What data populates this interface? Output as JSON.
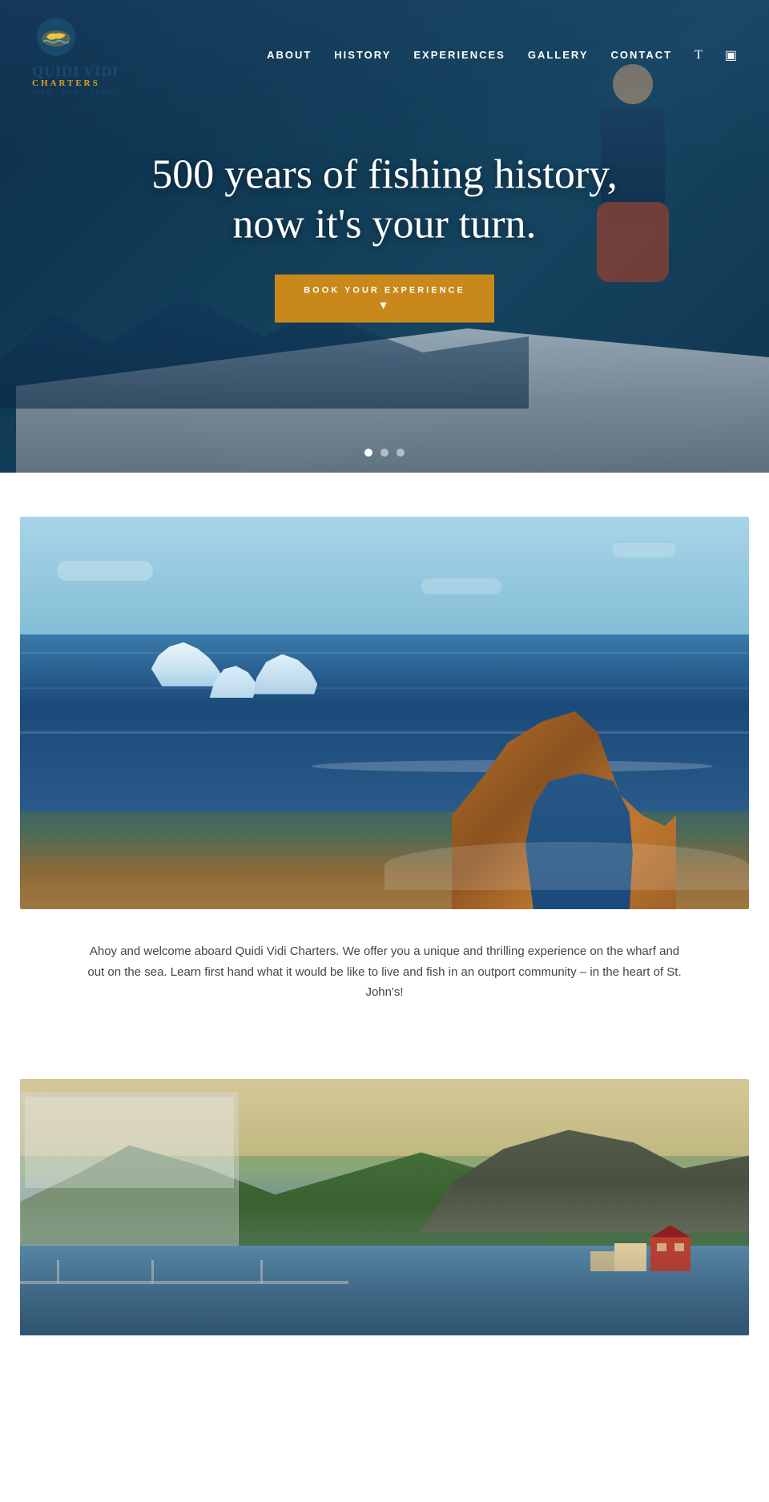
{
  "site": {
    "name_line1": "QUIDI VIDI",
    "name_line2": "CHARTERS",
    "tagline": "FISH · FUN · FEAST"
  },
  "nav": {
    "items": [
      {
        "id": "about",
        "label": "ABOUT"
      },
      {
        "id": "history",
        "label": "HISTORY"
      },
      {
        "id": "experiences",
        "label": "EXPERIENCES"
      },
      {
        "id": "gallery",
        "label": "GALLERY"
      },
      {
        "id": "contact",
        "label": "CONTACT"
      }
    ],
    "icon1": "T",
    "icon2": "▣"
  },
  "hero": {
    "title": "500 years of fishing history, now it's your turn.",
    "cta_label": "BOOK YOUR EXPERIENCE",
    "cta_arrow": "▼",
    "dots": [
      {
        "active": true
      },
      {
        "active": false
      },
      {
        "active": false
      }
    ]
  },
  "coastal": {
    "description": "Ahoy and welcome aboard Quidi Vidi Charters. We offer you a unique and thrilling experience on the wharf and out on the sea. Learn first hand what it would be like to live and fish in an outport community – in the heart of St. John's!"
  }
}
